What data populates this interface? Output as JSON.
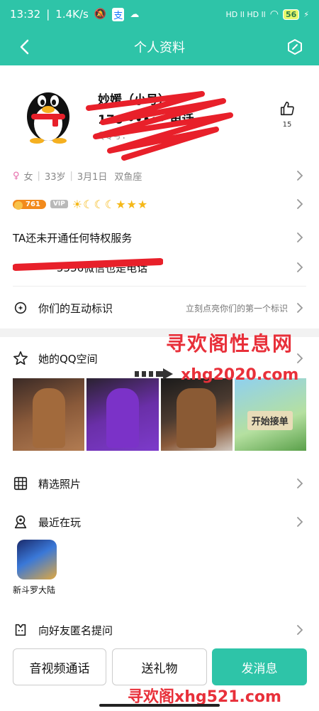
{
  "status_bar": {
    "time": "13:32",
    "net_speed": "1.4K/s",
    "network": "HD ll HD ll",
    "battery": "56"
  },
  "nav": {
    "title": "个人资料"
  },
  "profile": {
    "name": "妙媛（小号）",
    "subname": "176 ••••• 电话",
    "qq_label": "QQ号：",
    "likes": "15"
  },
  "info": {
    "gender": "女",
    "age": "33岁",
    "birthday": "3月1日",
    "zodiac": "双鱼座"
  },
  "badges": {
    "level": "761",
    "vip": "VIP",
    "level_icons": "☀☾☾☾★★★"
  },
  "service_text": "TA还未开通任何特权服务",
  "phone_text": "•••••••5536微信也是电话",
  "interact": {
    "label": "你们的互动标识",
    "hint": "立刻点亮你们的第一个标识"
  },
  "qzone": {
    "label": "她的QQ空间",
    "photo4_text": "开始接单"
  },
  "featured_photos": "精选照片",
  "recent": {
    "label": "最近在玩",
    "game_name": "新斗罗大陆"
  },
  "anon_question": "向好友匿名提问",
  "buttons": {
    "call": "音视频通话",
    "gift": "送礼物",
    "message": "发消息"
  },
  "watermarks": {
    "top": "寻欢阁性息网",
    "mid": "xhg2020.com",
    "bottom": "寻欢阁xhg521.com"
  },
  "colors": {
    "brand": "#2ec4a8",
    "watermark": "#e8303a"
  }
}
